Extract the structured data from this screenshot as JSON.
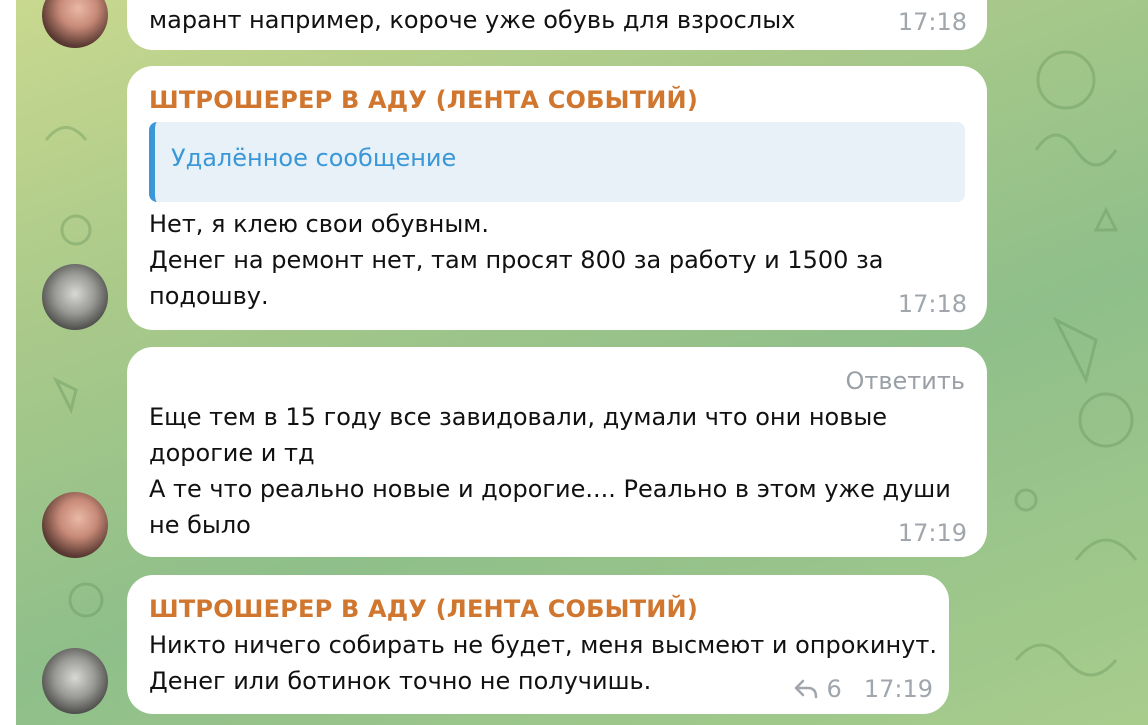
{
  "messages": [
    {
      "text": "марант например, короче уже обувь для взрослых",
      "time": "17:18"
    },
    {
      "sender": "ШТРОШЕРЕР В АДУ (ЛЕНТА СОБЫТИЙ)",
      "reply_quote": "Удалённое сообщение",
      "text": "Нет, я клею свои обувным.\nДенег на ремонт нет, там просят 800 за работу и 1500 за подошву.",
      "time": "17:18"
    },
    {
      "reply_label": "Ответить",
      "text": "Еще тем в 15 году все завидовали, думали что они новые дорогие и тд\nА те что реально новые и дорогие.... Реально в этом уже души не было",
      "time": "17:19"
    },
    {
      "sender": "ШТРОШЕРЕР В АДУ (ЛЕНТА СОБЫТИЙ)",
      "text": "Никто ничего собирать не будет, меня высмеют и опрокинут.\nДенег или ботинок точно не получишь.",
      "reply_count": "6",
      "time": "17:19"
    }
  ],
  "colors": {
    "sender": "#d0762e",
    "quote_accent": "#3a98d8",
    "timestamp": "#a0a6ab"
  }
}
